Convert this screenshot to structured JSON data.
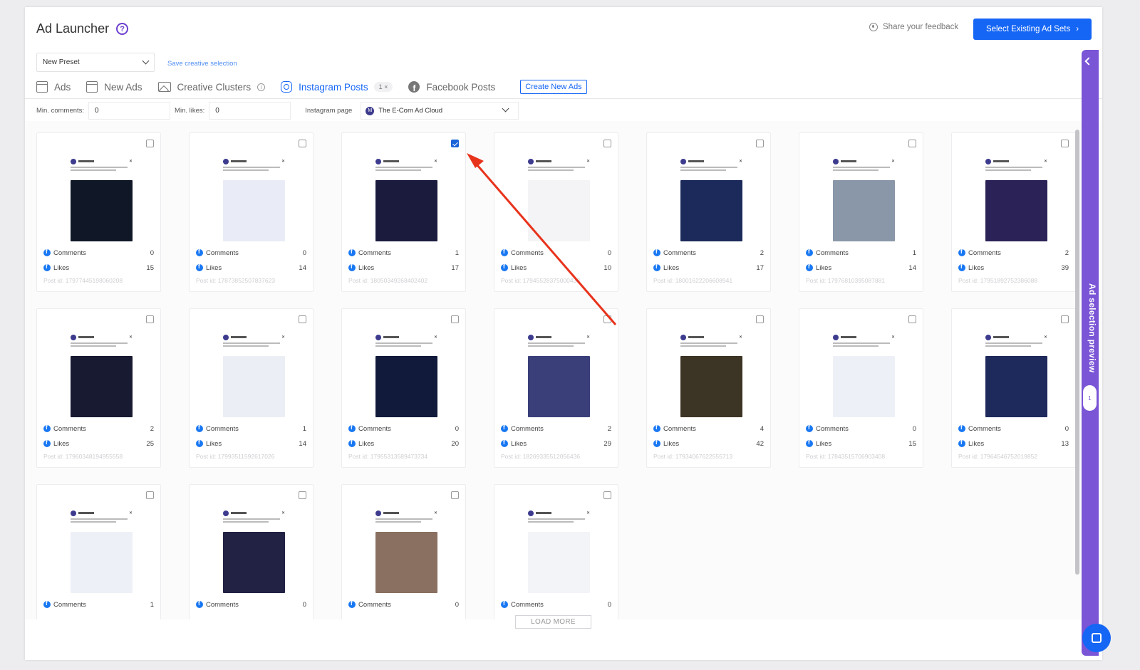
{
  "header": {
    "title": "Ad Launcher",
    "help": "?",
    "feedback": "Share your feedback",
    "select_button": "Select Existing Ad Sets",
    "select_arrow": "›"
  },
  "preset": {
    "value": "New Preset",
    "save_link": "Save creative selection"
  },
  "tabs": [
    {
      "label": "Ads",
      "icon": "document-icon"
    },
    {
      "label": "New Ads",
      "icon": "document-icon"
    },
    {
      "label": "Creative Clusters",
      "icon": "image-icon",
      "info": "i"
    },
    {
      "label": "Instagram Posts",
      "icon": "instagram-icon",
      "active": true,
      "count": "1 ×"
    },
    {
      "label": "Facebook Posts",
      "icon": "facebook-icon"
    }
  ],
  "create_new": "Create New Ads",
  "filters": {
    "min_comments_label": "Min. comments:",
    "min_comments_value": "0",
    "min_likes_label": "Min. likes:",
    "min_likes_value": "0",
    "page_label": "Instagram page",
    "page_value": "The E-Com Ad Cloud",
    "page_avatar": "M"
  },
  "labels": {
    "comments": "Comments",
    "likes": "Likes"
  },
  "posts": [
    {
      "comments": "0",
      "likes": "15",
      "post_id": "Post id: 17977445198060208",
      "checked": false,
      "color": "#101828"
    },
    {
      "comments": "0",
      "likes": "14",
      "post_id": "Post id: 17873852507837623",
      "checked": false,
      "color": "#e9ecf6"
    },
    {
      "comments": "1",
      "likes": "17",
      "post_id": "Post id: 18050349268402402",
      "checked": true,
      "color": "#1a1b3d"
    },
    {
      "comments": "0",
      "likes": "10",
      "post_id": "Post id: 17945528375000433",
      "checked": false,
      "color": "#f4f4f6"
    },
    {
      "comments": "2",
      "likes": "17",
      "post_id": "Post id: 18001622206608941",
      "checked": false,
      "color": "#1b2a5a"
    },
    {
      "comments": "1",
      "likes": "14",
      "post_id": "Post id: 17976810395087881",
      "checked": false,
      "color": "#8a97a8"
    },
    {
      "comments": "2",
      "likes": "39",
      "post_id": "Post id: 17951892752386088",
      "checked": false,
      "color": "#2b2357"
    },
    {
      "comments": "2",
      "likes": "25",
      "post_id": "Post id: 17960348194955558",
      "checked": false,
      "color": "#171a30"
    },
    {
      "comments": "1",
      "likes": "14",
      "post_id": "Post id: 17993511592617026",
      "checked": false,
      "color": "#eceef6"
    },
    {
      "comments": "0",
      "likes": "20",
      "post_id": "Post id: 17955313589473734",
      "checked": false,
      "color": "#111a3a"
    },
    {
      "comments": "2",
      "likes": "29",
      "post_id": "Post id: 18269335512056436",
      "checked": false,
      "color": "#3a3f7a"
    },
    {
      "comments": "4",
      "likes": "42",
      "post_id": "Post id: 17934067622555713",
      "checked": false,
      "color": "#3c3424"
    },
    {
      "comments": "0",
      "likes": "15",
      "post_id": "Post id: 17843515706903408",
      "checked": false,
      "color": "#eef0f7"
    },
    {
      "comments": "0",
      "likes": "13",
      "post_id": "Post id: 17964546752019852",
      "checked": false,
      "color": "#1e2a5c"
    },
    {
      "comments": "1",
      "likes": "",
      "post_id": "",
      "checked": false,
      "color": "#eef0f8"
    },
    {
      "comments": "0",
      "likes": "",
      "post_id": "",
      "checked": false,
      "color": "#222244"
    },
    {
      "comments": "0",
      "likes": "",
      "post_id": "",
      "checked": false,
      "color": "#8a7060"
    },
    {
      "comments": "0",
      "likes": "",
      "post_id": "",
      "checked": false,
      "color": "#f3f4f7"
    }
  ],
  "load_more": "LOAD MORE",
  "sidebar": {
    "label": "Ad selection preview",
    "badge": "1"
  },
  "colors": {
    "primary": "#1566f5",
    "sidebar": "#7a55d6",
    "annotation_arrow": "#e8331c"
  }
}
